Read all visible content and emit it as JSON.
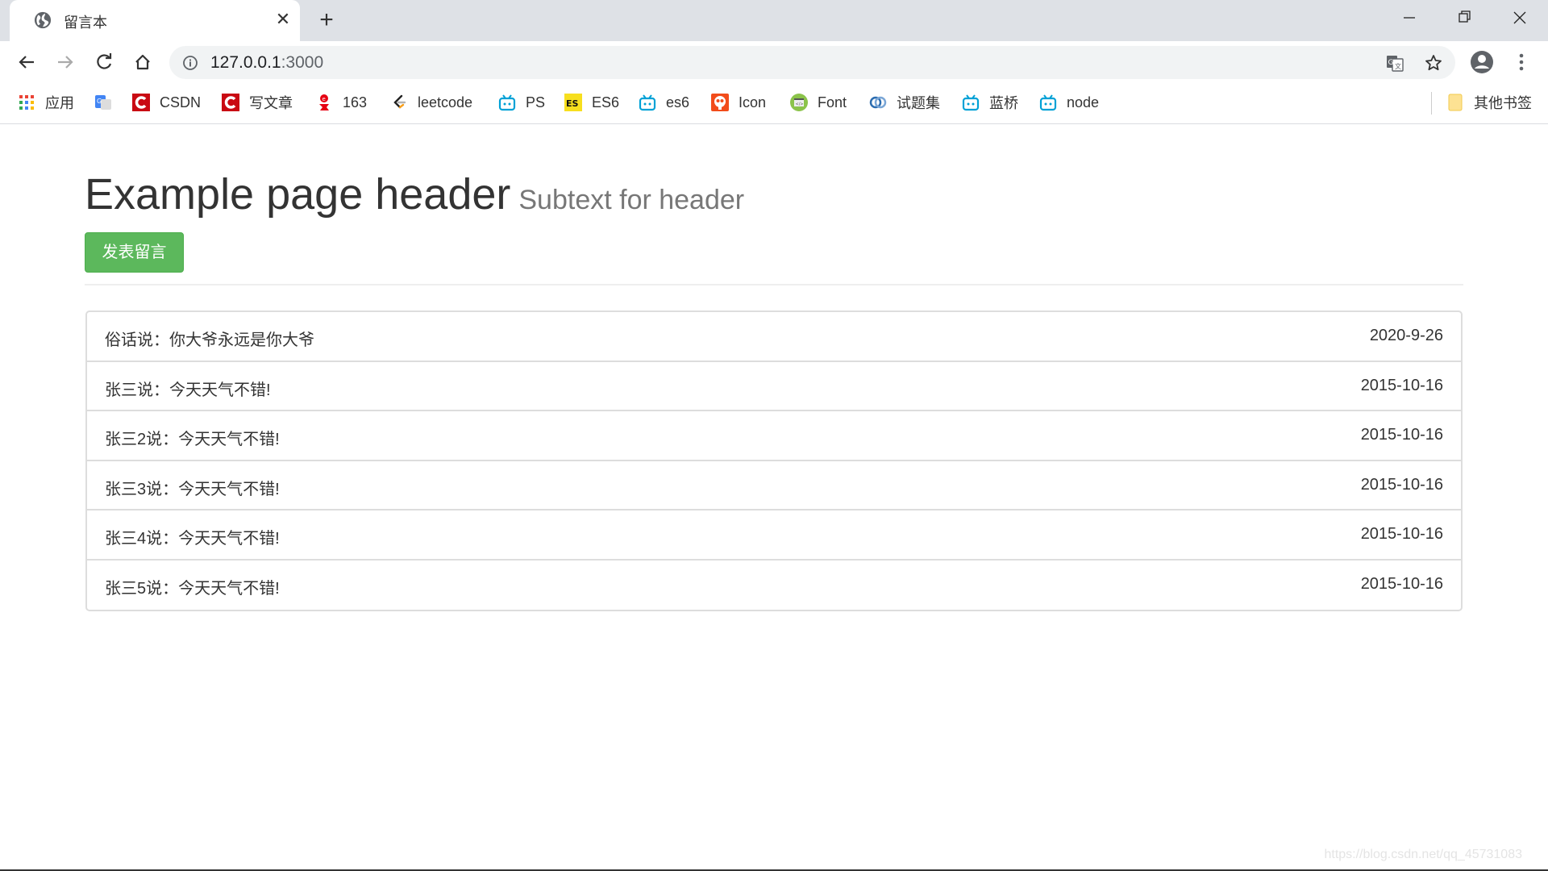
{
  "browser": {
    "tab": {
      "title": "留言本",
      "favicon": "globe-icon"
    },
    "new_tab_label": "+",
    "window_controls": [
      "minimize",
      "restore",
      "close"
    ],
    "address": {
      "host": "127.0.0.1",
      "port": ":3000"
    },
    "bookmarks": [
      {
        "label": "应用",
        "icon": "apps-grid-icon"
      },
      {
        "label": "",
        "icon": "google-translate-icon"
      },
      {
        "label": "CSDN",
        "icon": "csdn-icon"
      },
      {
        "label": "写文章",
        "icon": "csdn-icon"
      },
      {
        "label": "163",
        "icon": "netease-icon"
      },
      {
        "label": "leetcode",
        "icon": "leetcode-icon"
      },
      {
        "label": "PS",
        "icon": "bilibili-icon"
      },
      {
        "label": "ES6",
        "icon": "es-icon"
      },
      {
        "label": "es6",
        "icon": "bilibili-icon"
      },
      {
        "label": "Icon",
        "icon": "iconfont-icon"
      },
      {
        "label": "Font",
        "icon": "code-icon"
      },
      {
        "label": "试题集",
        "icon": "swirl-icon"
      },
      {
        "label": "蓝桥",
        "icon": "bilibili-icon"
      },
      {
        "label": "node",
        "icon": "bilibili-icon"
      }
    ],
    "other_bookmarks": "其他书签"
  },
  "page": {
    "header": {
      "title": "Example page header",
      "subtext": "Subtext for header"
    },
    "post_button": "发表留言",
    "messages": [
      {
        "text": "俗话说：你大爷永远是你大爷",
        "date": "2020-9-26"
      },
      {
        "text": "张三说：今天天气不错!",
        "date": "2015-10-16"
      },
      {
        "text": "张三2说：今天天气不错!",
        "date": "2015-10-16"
      },
      {
        "text": "张三3说：今天天气不错!",
        "date": "2015-10-16"
      },
      {
        "text": "张三4说：今天天气不错!",
        "date": "2015-10-16"
      },
      {
        "text": "张三5说：今天天气不错!",
        "date": "2015-10-16"
      }
    ]
  },
  "watermark": "https://blog.csdn.net/qq_45731083",
  "colors": {
    "success": "#5cb85c",
    "tabbar": "#dee1e6",
    "omnibox": "#f1f3f4"
  }
}
